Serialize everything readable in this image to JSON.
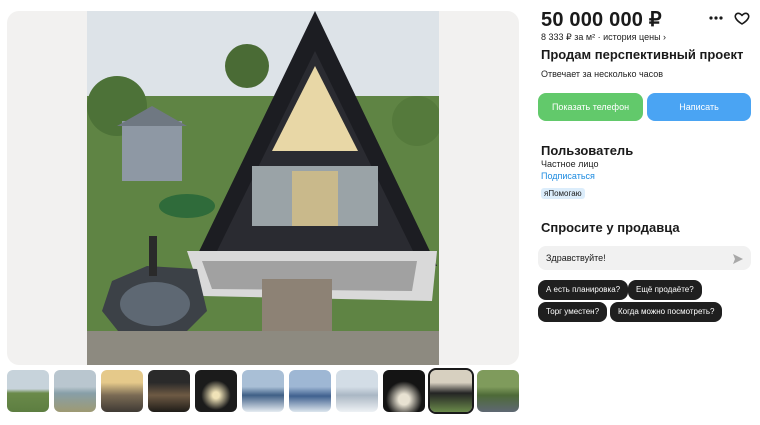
{
  "listing": {
    "price": "50 000 000 ₽",
    "price_per_m2": "8 333 ₽ за м²",
    "price_history": "история цены ›",
    "title": "Продам перспективный проект",
    "reply_time": "Отвечает за несколько часов"
  },
  "actions": {
    "show_phone": "Показать телефон",
    "write": "Написать"
  },
  "seller": {
    "name": "Пользователь",
    "type": "Частное лицо",
    "subscribe": "Подписаться",
    "badge": "яПомогаю"
  },
  "ask": {
    "title": "Спросите у продавца",
    "input_value": "Здравствуйте!",
    "chips": [
      "А есть планировка?",
      "Ещё продаёте?",
      "Торг уместен?",
      "Когда можно посмотреть?"
    ]
  },
  "gallery": {
    "thumbnail_count": 11,
    "active_thumbnail": 10
  },
  "icons": {
    "more": "more-horizontal-icon",
    "favorite": "heart-icon",
    "send": "send-arrow-icon"
  },
  "colors": {
    "green": "#62c96b",
    "blue": "#4aa4f3",
    "link": "#1d8be0",
    "chip": "#1f1f1f"
  }
}
